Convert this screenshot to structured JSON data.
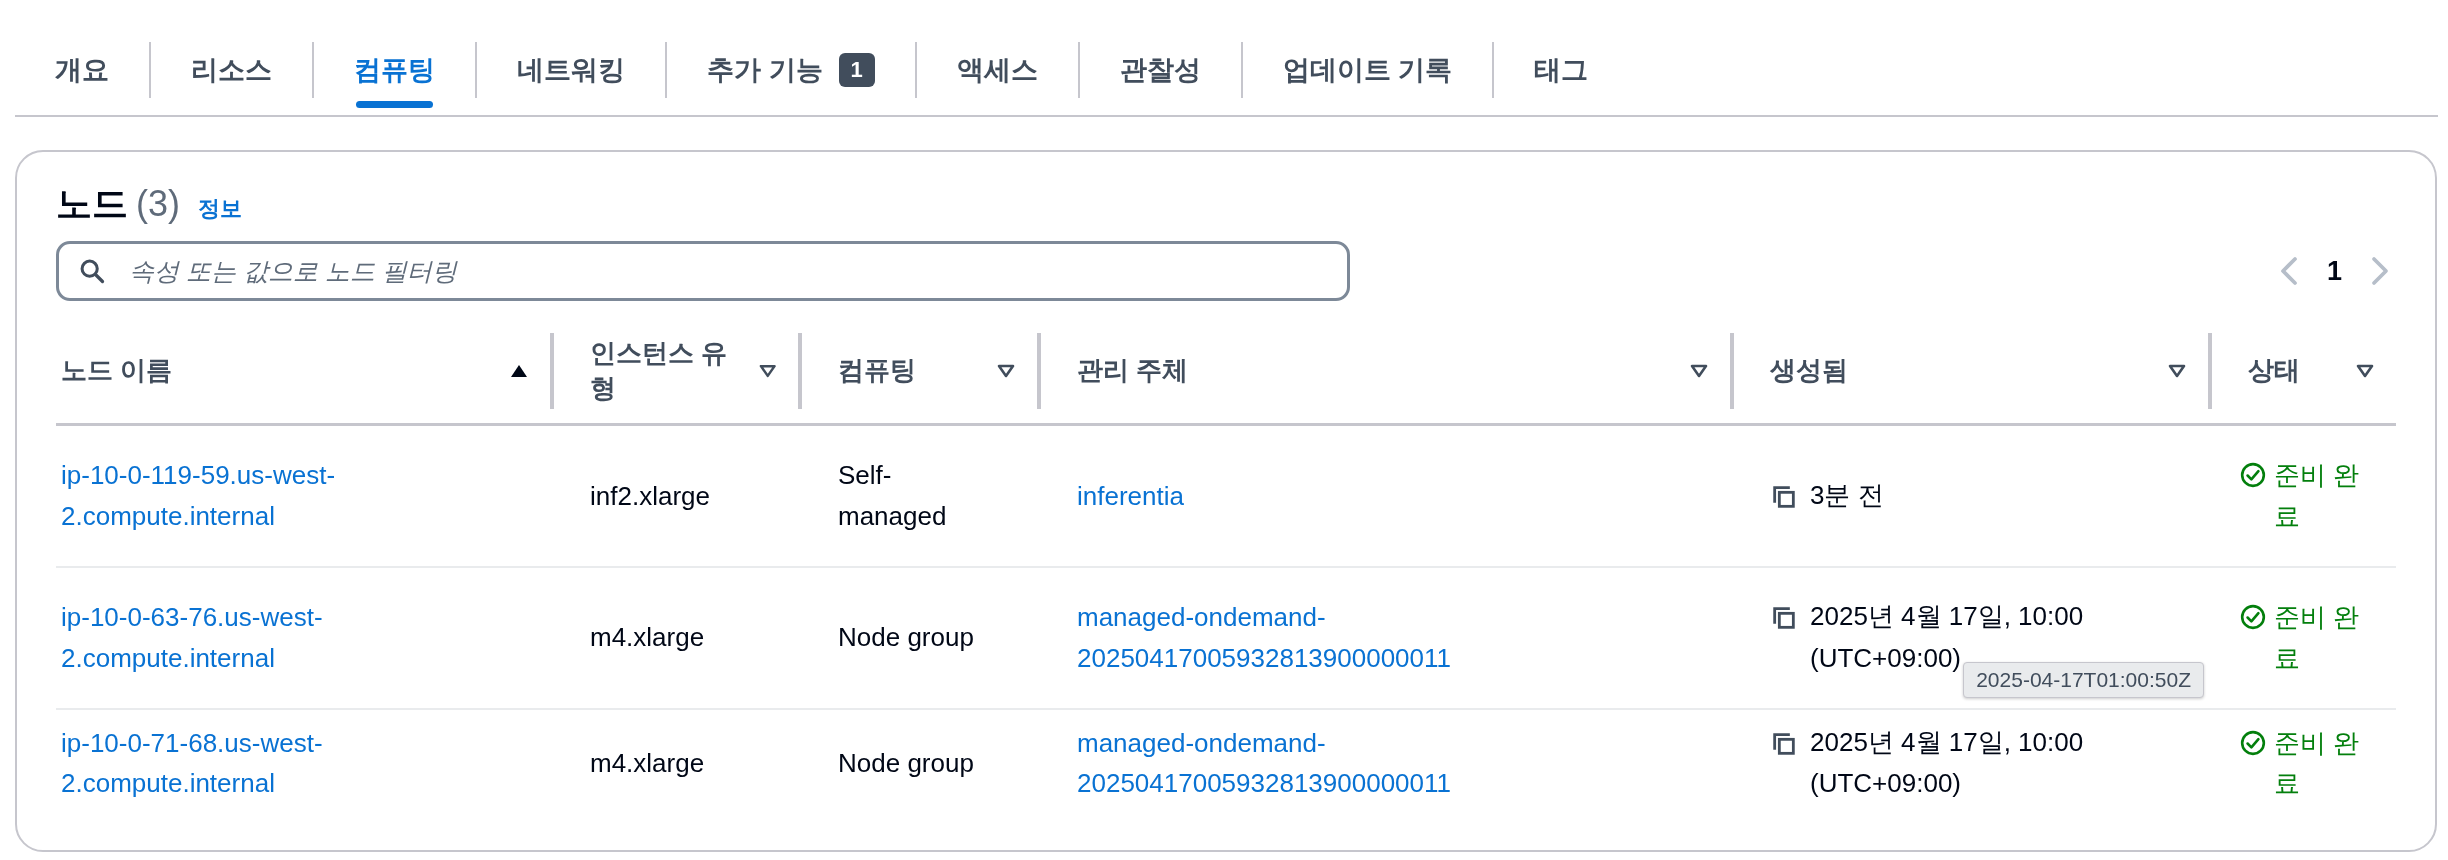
{
  "tabs": [
    {
      "label": "개요",
      "selected": false
    },
    {
      "label": "리소스",
      "selected": false
    },
    {
      "label": "컴퓨팅",
      "selected": true
    },
    {
      "label": "네트워킹",
      "selected": false
    },
    {
      "label": "추가 기능",
      "selected": false,
      "badge": "1"
    },
    {
      "label": "액세스",
      "selected": false
    },
    {
      "label": "관찰성",
      "selected": false
    },
    {
      "label": "업데이트 기록",
      "selected": false
    },
    {
      "label": "태그",
      "selected": false
    }
  ],
  "nodes_panel": {
    "title": "노드",
    "count": "(3)",
    "info_link": "정보",
    "search": {
      "placeholder": "속성 또는 값으로 노드 필터링"
    },
    "pagination": {
      "page": "1",
      "prev_disabled": true,
      "next_disabled": true
    },
    "table": {
      "columns": [
        {
          "label": "노드 이름",
          "sorted": true
        },
        {
          "label": "인스턴스 유형",
          "sorted": false
        },
        {
          "label": "컴퓨팅",
          "sorted": false
        },
        {
          "label": "관리 주체",
          "sorted": false
        },
        {
          "label": "생성됨",
          "sorted": false
        },
        {
          "label": "상태",
          "sorted": false
        }
      ],
      "rows": [
        {
          "node_name": "ip-10-0-119-59.us-west-2.compute.internal",
          "instance_type": "inf2.xlarge",
          "compute": "Self-managed",
          "managed_by": "inferentia",
          "created": "3분 전",
          "status": "준비 완료"
        },
        {
          "node_name": "ip-10-0-63-76.us-west-2.compute.internal",
          "instance_type": "m4.xlarge",
          "compute": "Node group",
          "managed_by": "managed-ondemand-20250417005932813900000011",
          "created": "2025년 4월 17일, 10:00 (UTC+09:00)",
          "created_tooltip": "2025-04-17T01:00:50Z",
          "status": "준비 완료"
        },
        {
          "node_name": "ip-10-0-71-68.us-west-2.compute.internal",
          "instance_type": "m4.xlarge",
          "compute": "Node group",
          "managed_by": "managed-ondemand-20250417005932813900000011",
          "created": "2025년 4월 17일, 10:00 (UTC+09:00)",
          "status": "준비 완료"
        }
      ]
    }
  }
}
